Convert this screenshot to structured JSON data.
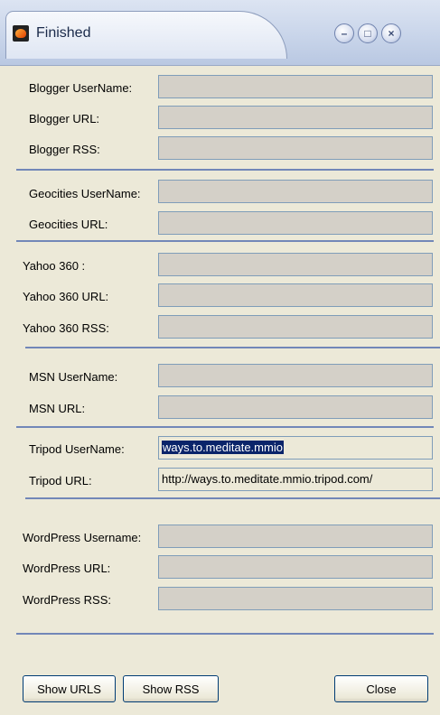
{
  "window": {
    "title": "Finished"
  },
  "sections": {
    "blogger": {
      "username_label": "Blogger UserName:",
      "username_value": "",
      "url_label": "Blogger URL:",
      "url_value": "",
      "rss_label": "Blogger RSS:",
      "rss_value": ""
    },
    "geocities": {
      "username_label": "Geocities UserName:",
      "username_value": "",
      "url_label": "Geocities URL:",
      "url_value": ""
    },
    "yahoo": {
      "username_label": "Yahoo 360 :",
      "username_value": "",
      "url_label": "Yahoo 360 URL:",
      "url_value": "",
      "rss_label": "Yahoo 360 RSS:",
      "rss_value": ""
    },
    "msn": {
      "username_label": "MSN UserName:",
      "username_value": "",
      "url_label": "MSN URL:",
      "url_value": ""
    },
    "tripod": {
      "username_label": "Tripod UserName:",
      "username_value": "ways.to.meditate.mmio",
      "url_label": "Tripod URL:",
      "url_value": "http://ways.to.meditate.mmio.tripod.com/"
    },
    "wordpress": {
      "username_label": "WordPress Username:",
      "username_value": "",
      "url_label": "WordPress URL:",
      "url_value": "",
      "rss_label": "WordPress RSS:",
      "rss_value": ""
    }
  },
  "buttons": {
    "show_urls": "Show URLS",
    "show_rss": "Show RSS",
    "close": "Close"
  },
  "icons": {
    "app": "app-icon",
    "minimize": "minimize-icon",
    "maximize": "maximize-icon",
    "close": "close-icon"
  }
}
